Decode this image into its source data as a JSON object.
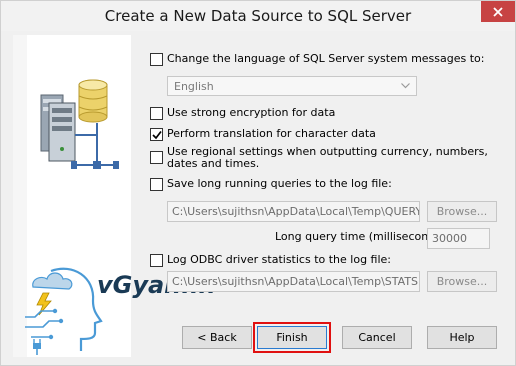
{
  "window": {
    "title": "Create a New Data Source to SQL Server",
    "close_glyph": "close-icon"
  },
  "options": {
    "change_language": {
      "label": "Change the language of SQL Server system messages to:",
      "checked": false
    },
    "language_select": {
      "value": "English"
    },
    "strong_encryption": {
      "label": "Use strong encryption for data",
      "checked": false
    },
    "translation": {
      "label": "Perform translation for character data",
      "checked": true
    },
    "regional_settings": {
      "label": "Use regional settings when outputting currency, numbers, dates and times.",
      "checked": false
    },
    "long_queries": {
      "label": "Save long running queries to the log file:",
      "checked": false
    },
    "long_queries_path": "C:\\Users\\sujithsn\\AppData\\Local\\Temp\\QUERY.LO",
    "long_queries_browse": "Browse...",
    "long_query_time_label": "Long query time (milliseconds):",
    "long_query_time_value": "30000",
    "odbc_stats": {
      "label": "Log ODBC driver statistics to the log file:",
      "checked": false
    },
    "odbc_stats_path": "C:\\Users\\sujithsn\\AppData\\Local\\Temp\\STATS.LO",
    "odbc_stats_browse": "Browse..."
  },
  "footer": {
    "back": "< Back",
    "finish": "Finish",
    "cancel": "Cancel",
    "help": "Help"
  },
  "watermark": {
    "text": "vGyan.in"
  },
  "colors": {
    "finish_highlight": "#e01010",
    "logo_text": "#1a3a55"
  }
}
